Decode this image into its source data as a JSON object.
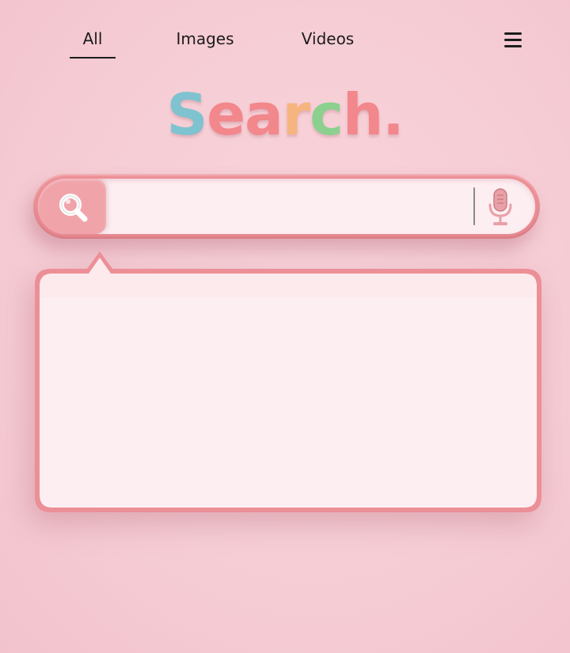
{
  "nav": {
    "tabs": [
      {
        "label": "All",
        "active": true
      },
      {
        "label": "Images",
        "active": false
      },
      {
        "label": "Videos",
        "active": false
      }
    ],
    "menu_icon": "hamburger-menu-icon"
  },
  "logo": {
    "letters": [
      {
        "char": "S",
        "color": "#7ec3cf"
      },
      {
        "char": "e",
        "color": "#f2878c"
      },
      {
        "char": "a",
        "color": "#f2878c"
      },
      {
        "char": "r",
        "color": "#f6b57e"
      },
      {
        "char": "c",
        "color": "#8bd08e"
      },
      {
        "char": "h",
        "color": "#f2878c"
      },
      {
        "char": ".",
        "color": "#f2878c"
      }
    ]
  },
  "search": {
    "value": "",
    "placeholder": "",
    "search_icon": "magnifier-icon",
    "mic_icon": "microphone-icon"
  },
  "colors": {
    "background": "#f6cdd5",
    "accent": "#ec8f96",
    "accent_light": "#f1a3aa",
    "surface": "#fdeef2",
    "text": "#1c1c1c"
  }
}
